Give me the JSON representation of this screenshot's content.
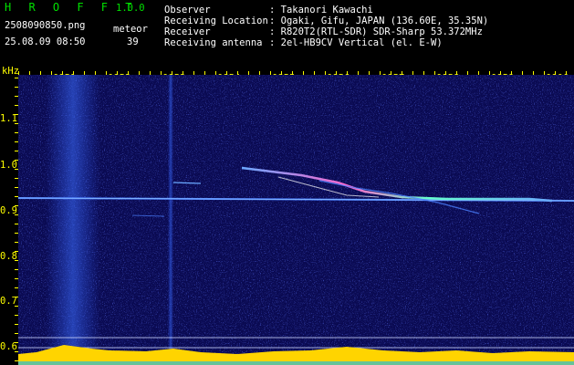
{
  "header": {
    "app_title": "H R O F F T",
    "app_version": "1.0.0",
    "filename": "2508090850.png",
    "datetime": "25.08.09 08:50",
    "meteor_label": "meteor",
    "meteor_count": "39",
    "observer_label": "Observer",
    "observer_value": ": Takanori Kawachi",
    "location_label": "Receiving Location",
    "location_value": ": Ogaki, Gifu, JAPAN (136.60E, 35.35N)",
    "receiver_label": "Receiver",
    "receiver_value": ": R820T2(RTL-SDR) SDR-Sharp 53.372MHz",
    "antenna_label": "Receiving antenna",
    "antenna_value": ": 2el-HB9CV Vertical (el. E-W)"
  },
  "axis": {
    "y_unit": "kHz",
    "x_ticks": [
      "0851",
      "0852",
      "0853",
      "0854",
      "0855",
      "0856",
      "0857",
      "0858",
      "0859",
      "0900"
    ],
    "y_ticks": [
      "1.1",
      "1.0",
      "0.9",
      "0.8",
      "0.7",
      "0.6"
    ]
  },
  "colors": {
    "background": "#000000",
    "spectrogram_bg": "#0a0a52",
    "text": "#ffffff",
    "axis": "#ffff00",
    "app_title": "#00e000",
    "baseline_fill": "#ffd400"
  }
}
